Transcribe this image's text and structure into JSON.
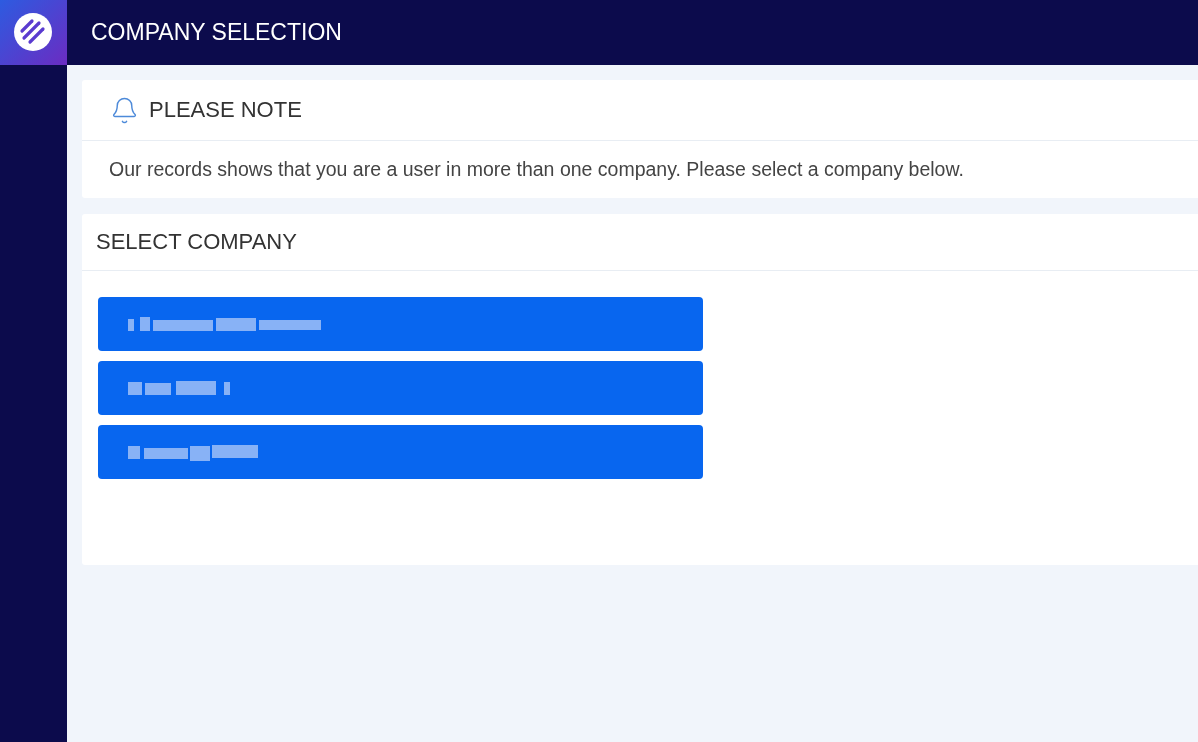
{
  "header": {
    "title": "COMPANY SELECTION"
  },
  "notice": {
    "title": "PLEASE NOTE",
    "message": "Our records shows that you are a user in more than one company. Please select a company below."
  },
  "company_panel": {
    "title": "SELECT COMPANY",
    "companies": [
      {
        "kind": "redacted"
      },
      {
        "kind": "redacted"
      },
      {
        "kind": "redacted"
      }
    ]
  }
}
